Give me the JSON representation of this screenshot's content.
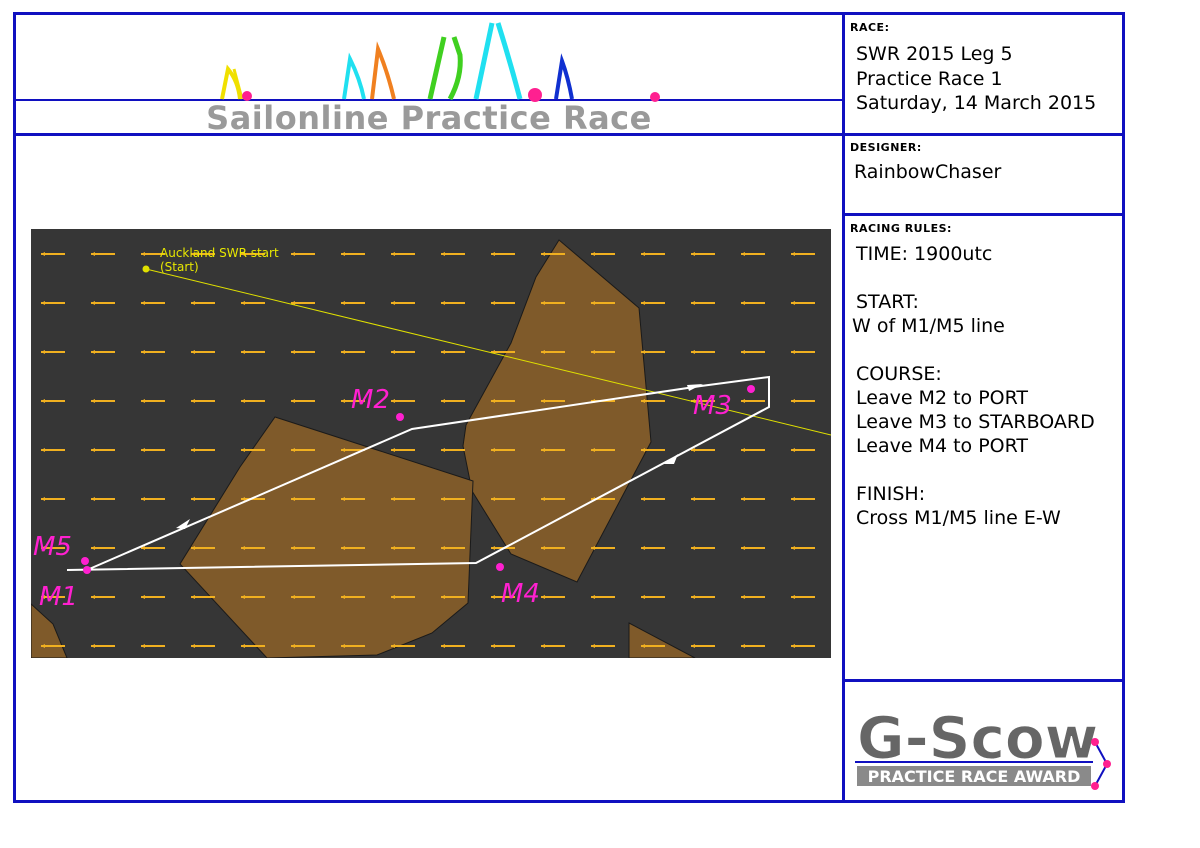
{
  "header": {
    "title": "Sailonline Practice Race"
  },
  "race": {
    "label": "RACE:",
    "line1": "SWR 2015 Leg 5",
    "line2": "Practice Race 1",
    "line3": "Saturday, 14 March 2015"
  },
  "designer": {
    "label": "DESIGNER:",
    "name": "RainbowChaser"
  },
  "rules": {
    "label": "RACING RULES:",
    "time": "TIME: 1900utc",
    "start_heading": "START:",
    "start_text": "W of M1/M5 line",
    "course_heading": "COURSE:",
    "course_1": "Leave M2 to PORT",
    "course_2": "Leave M3 to STARBOARD",
    "course_3": "Leave M4 to PORT",
    "finish_heading": "FINISH:",
    "finish_text": "Cross M1/M5 line E-W"
  },
  "map": {
    "start_label": "Auckland SWR start",
    "start_sub": "(Start)",
    "marks": [
      "M1",
      "M2",
      "M3",
      "M4",
      "M5"
    ],
    "colors": {
      "water": "#363636",
      "land": "#7f5a2a",
      "wind": "#f0b020",
      "mark": "#ff20d0",
      "route": "#ffffff",
      "start_line": "#e0e000"
    }
  },
  "award": {
    "title": "G-Scow",
    "subtitle": "PRACTICE RACE AWARD"
  }
}
